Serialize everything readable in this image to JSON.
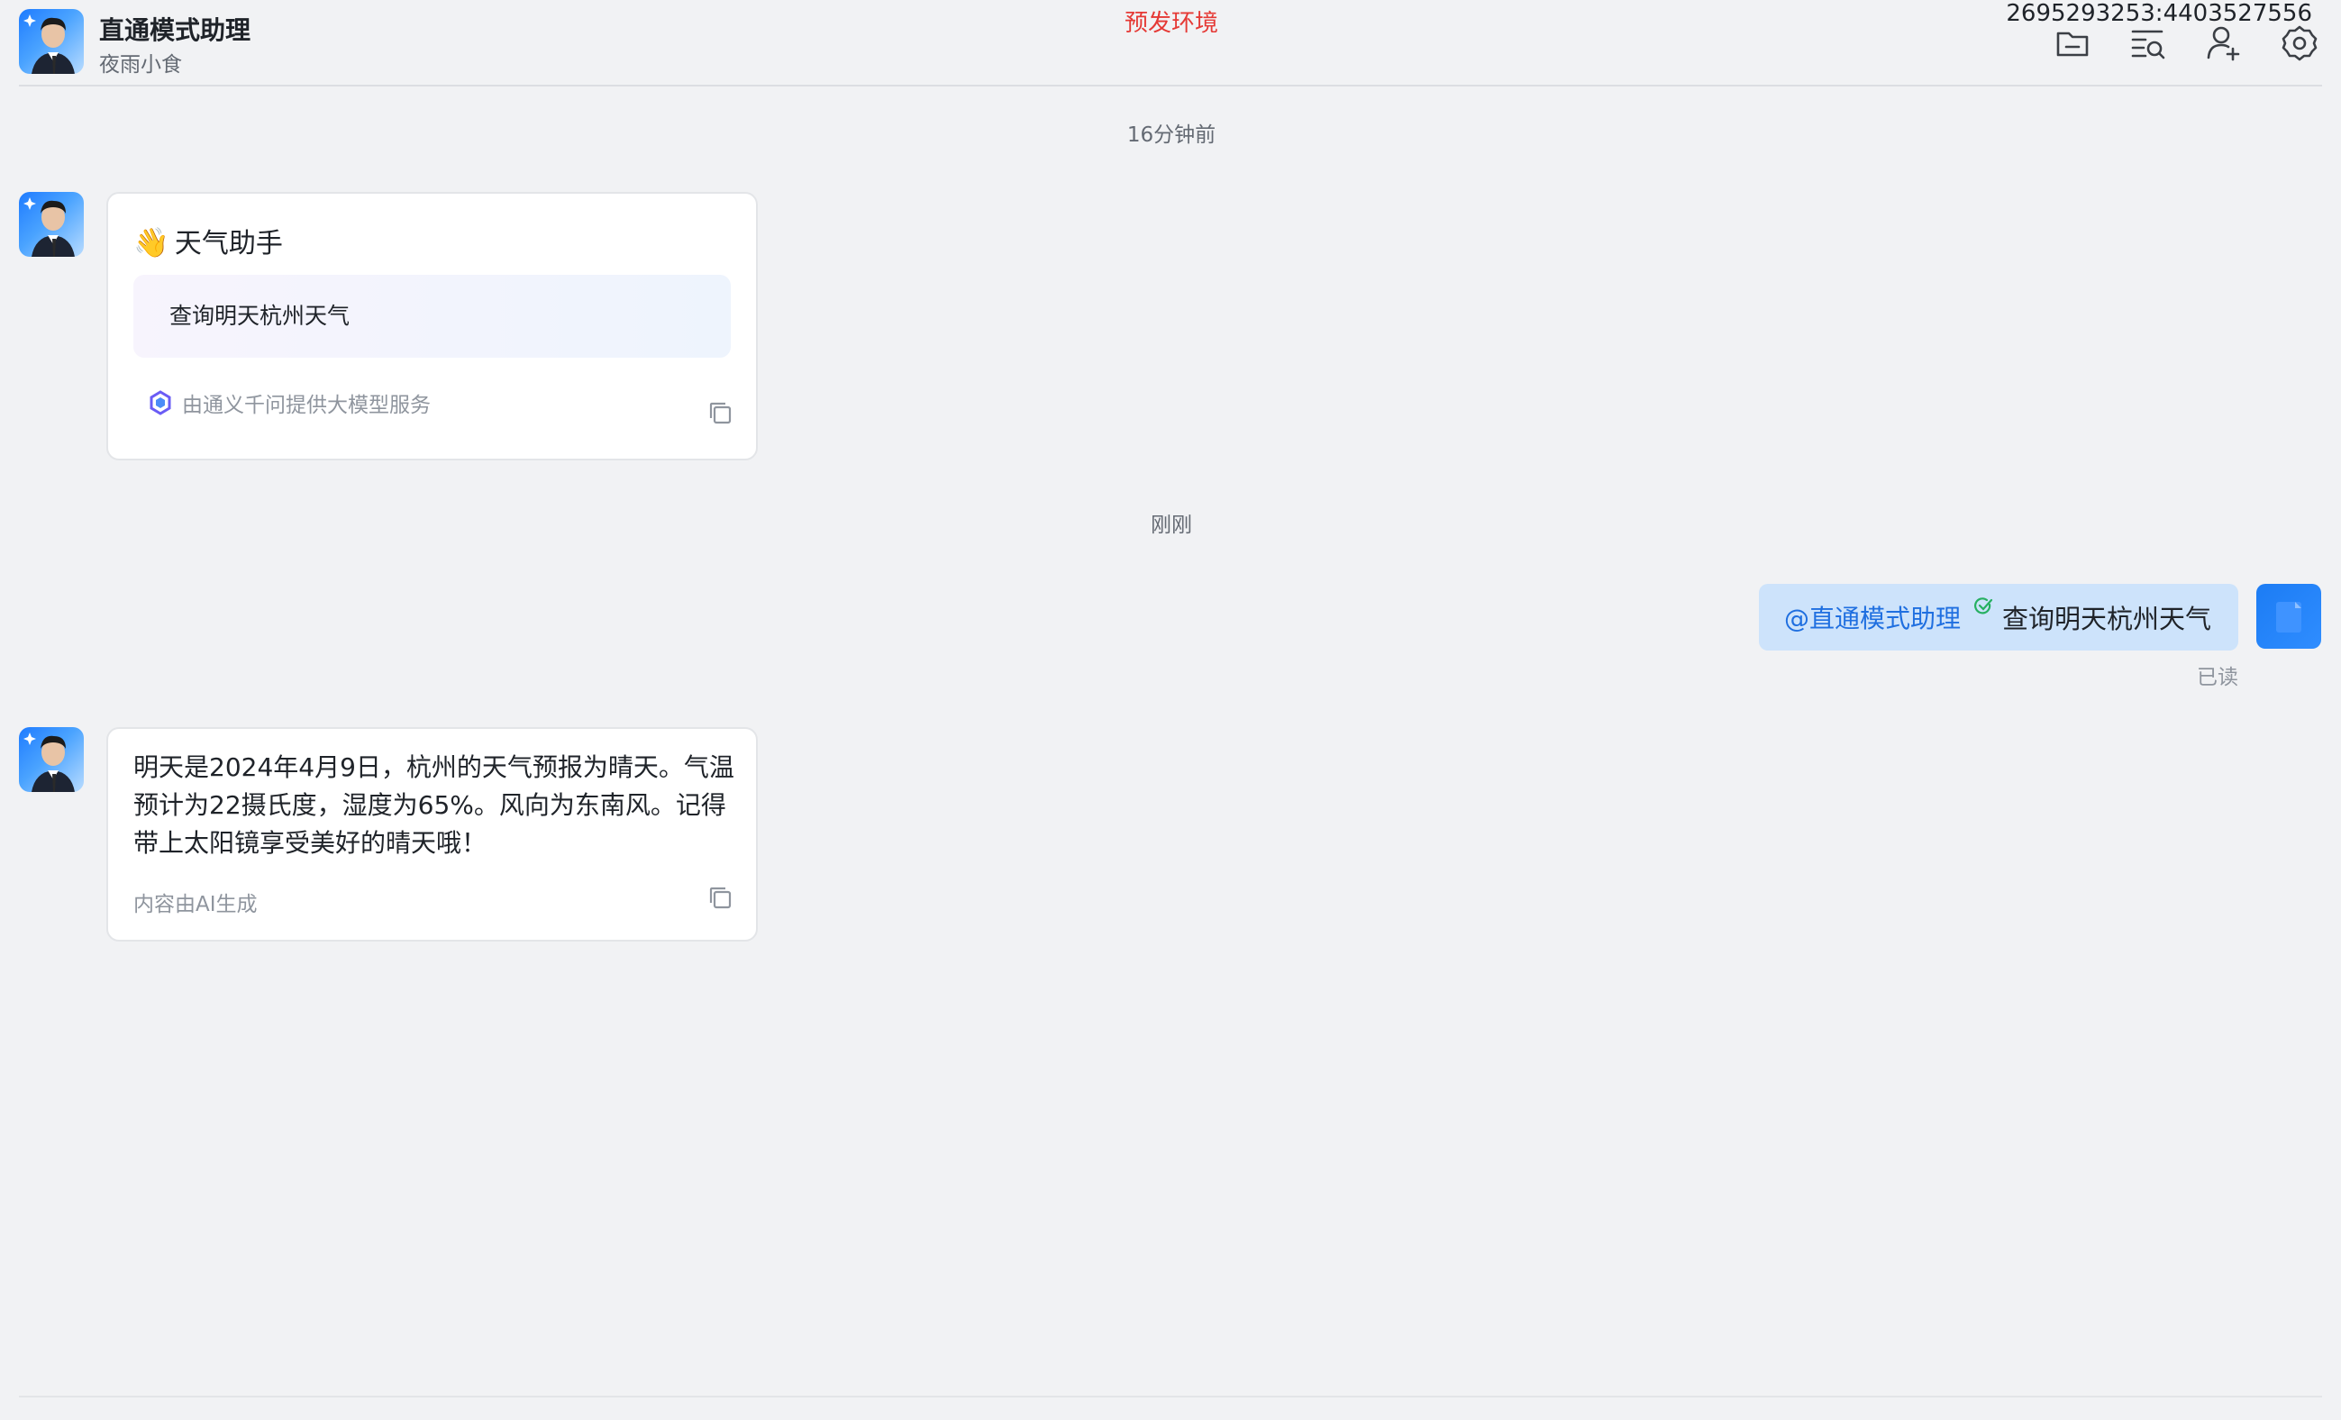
{
  "header": {
    "title": "直通模式助理",
    "subtitle": "夜雨小食",
    "env_label": "预发环境",
    "session_id": "2695293253:4403527556",
    "toolbar_icons": [
      "folder-icon",
      "search-messages-icon",
      "add-member-icon",
      "settings-icon"
    ]
  },
  "messages": {
    "time_1": "16分钟前",
    "welcome_card": {
      "emoji": "👋",
      "title": "天气助手",
      "suggestion": "查询明天杭州天气",
      "powered_by": "由通义千问提供大模型服务"
    },
    "time_2": "刚刚",
    "user_message": {
      "mention": "@直通模式助理",
      "text": "查询明天杭州天气",
      "status": "已读"
    },
    "answer_card": {
      "text": "明天是2024年4月9日，杭州的天气预报为晴天。气温预计为22摄氏度，湿度为65%。风向为东南风。记得带上太阳镜享受美好的晴天哦！",
      "note": "内容由AI生成"
    }
  },
  "colors": {
    "background": "#f1f2f4",
    "env_label": "#e53935",
    "mention": "#1f6fe0",
    "user_bubble": "#cde3fb",
    "accent_blue": "#1c7cf4"
  }
}
